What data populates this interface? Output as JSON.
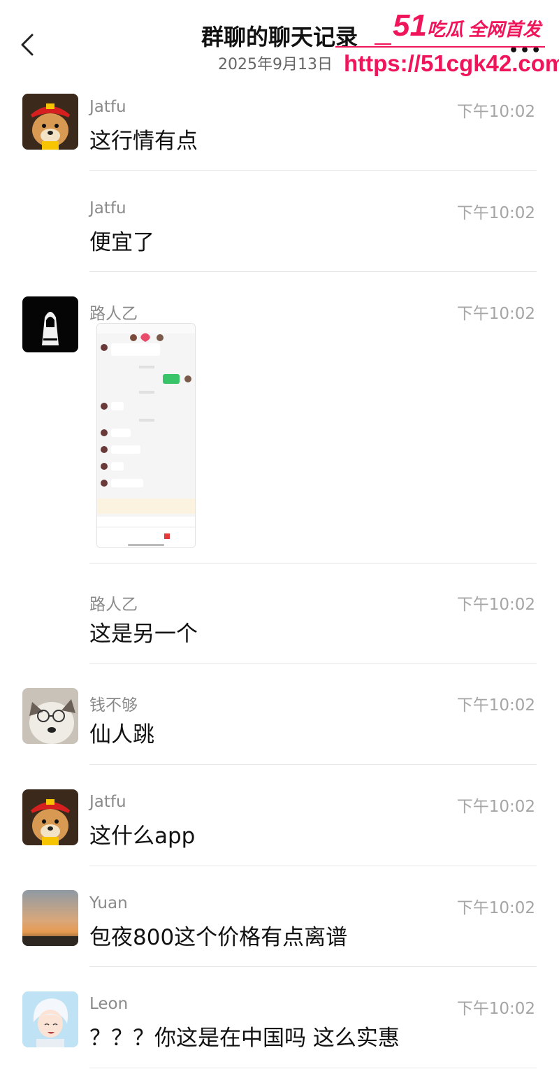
{
  "header": {
    "title": "群聊的聊天记录",
    "date": "2025年9月13日",
    "back_icon": "chevron-left-icon",
    "more_icon": "more-dots-icon"
  },
  "watermark": {
    "logo_number": "51",
    "logo_text": "吃瓜 全网首发",
    "url": "https://51cgk42.com",
    "color": "#f0145a"
  },
  "messages": [
    {
      "name": "Jatfu",
      "time": "下午10:02",
      "text": "这行情有点",
      "avatar": "shiba-dog-avatar"
    },
    {
      "name": "Jatfu",
      "time": "下午10:02",
      "text": "便宜了"
    },
    {
      "name": "路人乙",
      "time": "下午10:02",
      "text": "",
      "avatar": "dark-hooded-figure-avatar",
      "image": "chat-screenshot-image"
    },
    {
      "name": "路人乙",
      "time": "下午10:02",
      "text": "这是另一个"
    },
    {
      "name": "钱不够",
      "time": "下午10:02",
      "text": "仙人跳",
      "avatar": "husky-glasses-avatar"
    },
    {
      "name": "Jatfu",
      "time": "下午10:02",
      "text": "这什么app",
      "avatar": "shiba-dog-avatar"
    },
    {
      "name": "Yuan",
      "time": "下午10:02",
      "text": "包夜800这个价格有点离谱",
      "avatar": "sunset-sky-avatar"
    },
    {
      "name": "Leon",
      "time": "下午10:02",
      "text": "？？？你这是在中国吗  这么实惠",
      "avatar": "anime-boy-avatar"
    }
  ]
}
